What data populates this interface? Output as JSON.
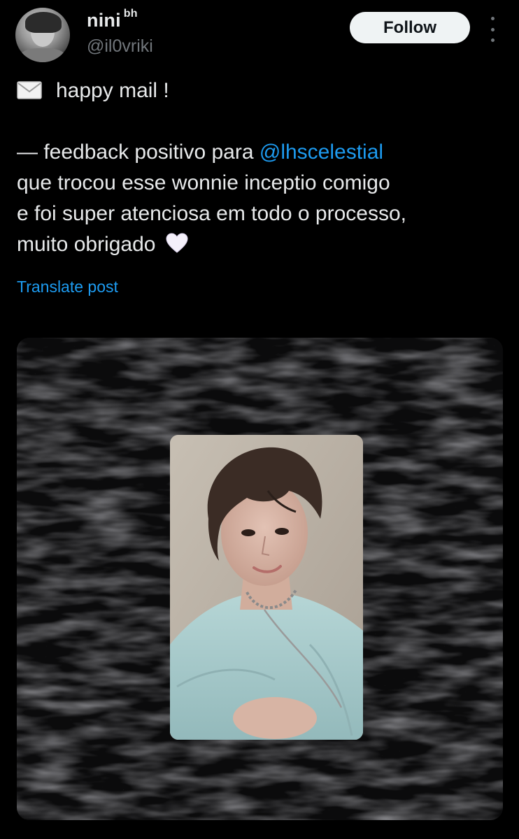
{
  "author": {
    "name": "nini",
    "name_suffix": "bh",
    "handle": "@il0vriki"
  },
  "actions": {
    "follow_label": "Follow",
    "more_icon": "more-vertical-icon"
  },
  "post": {
    "line1_icon": "envelope-icon",
    "line1_text": "happy mail !",
    "line3_prefix": "— feedback positivo para ",
    "mention": "@lhscelestial",
    "line4": "que trocou esse wonnie inceptio comigo",
    "line5": "e foi super atenciosa em todo o processo,",
    "line6_text": "muito obrigado",
    "line6_icon": "white-heart-icon",
    "translate_label": "Translate post"
  },
  "colors": {
    "background": "#000000",
    "text": "#e7e9ea",
    "muted": "#71767b",
    "accent": "#1d9bf0",
    "button_bg": "#eff3f4"
  }
}
